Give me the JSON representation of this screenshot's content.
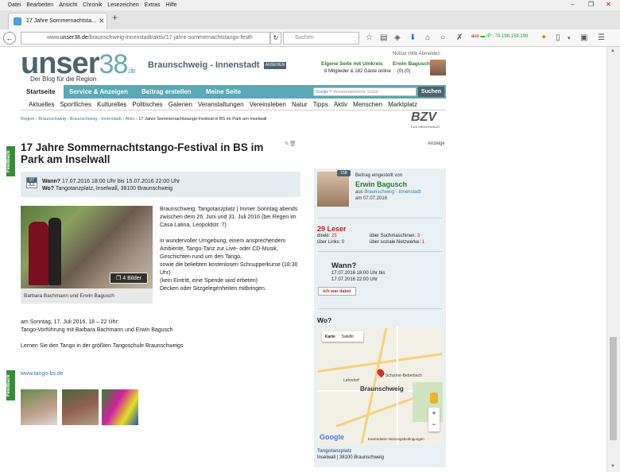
{
  "browser": {
    "menu": [
      "Datei",
      "Bearbeiten",
      "Ansicht",
      "Chronik",
      "Lesezeichen",
      "Extras",
      "Hilfe"
    ],
    "tab_title": "17 Jahre Sommernachtsta...",
    "url_prefix": "www.",
    "url_domain": "unser38.de",
    "url_path": "/braunschweig-innenstadt/aktiv/17-jahre-sommernachtstango-festh",
    "search_placeholder": "Suchen",
    "ip_label": "aus",
    "ip_text": "IP : 79.198.159.198"
  },
  "header": {
    "logo_main": "unser",
    "logo_num": "38",
    "logo_de": ".de",
    "tagline": "Der Blog für die Region",
    "region": "Braunschweig - Innenstadt",
    "region_badge": "ANSEHEN",
    "toplinks": "Nutzer   Hilfe   Abmelden",
    "eigene": "Eigene Seite mit Umkreis",
    "mitglied": "8 Mitglieder & 182 Gäste online",
    "username": "Erwin Bagusch",
    "usercounts": "(0)  (0)"
  },
  "nav": {
    "tabs": [
      "Startseite",
      "Service & Anzeigen",
      "Beitrag erstellen",
      "Meine Seite"
    ],
    "search_placeholder": "Benutzerdefinierte Suche",
    "search_btn": "Suchen",
    "sub": [
      "Aktuelles",
      "Sportliches",
      "Kulturelles",
      "Politisches",
      "Galerien",
      "Veranstaltungen",
      "Vereinsleben",
      "Natur",
      "Tipps",
      "Aktiv",
      "Menschen",
      "Marktplatz"
    ]
  },
  "breadcrumb": {
    "items": [
      "Region",
      "Braunschweig",
      "Braunschweig - Innenstadt",
      "Aktiv"
    ],
    "current": "17 Jahre Sommernachtstango-Festival in BS im Park am Inselwall"
  },
  "bzv": {
    "logo": "BZV",
    "sub": "DAS MEDIENHAUS"
  },
  "article": {
    "title": "17 Jahre Sommernachtstango-Festival in BS im Park am Inselwall",
    "anzeige": "Anzeige",
    "cal_month": "07",
    "cal_day": "JUL",
    "wann_label": "Wann?",
    "wann_value": "17.07.2016 18:00 Uhr bis 15.07.2016 22:00 Uhr",
    "wo_label": "Wo?",
    "wo_value": "Tangotanzplatz, Inselwall, 38100 Braunschweig",
    "bilder": "4 Bilder",
    "caption": "Barbara Bachmann und Erwin Bagusch",
    "p1": "Braunschweig: Tangotanzplatz | Immer Sonntag abends zwischen dem 26. Juni und 31. Juli 2016 (bei Regen im Casa Latina, Leopoldstr. 7)",
    "p2": "in wundervoller Umgebung, einem ansprechendem",
    "p3": "Ambiente, Tango-Tanz zur Live- oder CD-Musik, Geschichten rund um den Tango,",
    "p4": "sowie die beliebten kostenlosen Schnupperkurse (18:30 Uhr)",
    "p5": "(kein Eintritt, eine Spende wird erbeten)",
    "p6": "Decken oder Sitzgelegenheiten mitbringen.",
    "p7": "am Sonntag, 17. Juli 2016, 18 – 22 Uhr:",
    "p8": "Tango-Vorführung mit Barbara Bachmann und Erwin Bagusch",
    "p9": "Lernen Sie den Tango in der größten Tangoschule Braunschweigs",
    "link": "www.tango-bs.de",
    "feedback": "Feedback"
  },
  "sidebar": {
    "count": "158",
    "posted_by": "Beitrag eingestellt von",
    "name": "Erwin Bagusch",
    "aus_label": "aus",
    "aus_region": "Braunschweig - Innenstadt",
    "am": "am 07.07.2016",
    "leser": "29 Leser",
    "direkt_label": "direkt:",
    "direkt_val": "25",
    "links_label": "über Links:",
    "links_val": "0",
    "such_label": "über Suchmaschinen:",
    "such_val": "3",
    "soz_label": "über soziale Netzwerke:",
    "soz_val": "1",
    "wann": "Wann?",
    "wann_1": "17.07.2016 18:00 Uhr bis",
    "wann_2": "17.07.2016 22:00 Uhr",
    "dabei_btn": "Ich war dabei",
    "wo": "Wo?",
    "map_tab1": "Karte",
    "map_tab2": "Satellit",
    "map_city": "Braunschweig",
    "map_lehndorf": "Lehndorf",
    "map_schunter": "Schunter-Beberbach",
    "map_footer": "Kartendaten   Nutzungsbedingungen",
    "google": "Google",
    "place": "Tangotanzplatz",
    "address": "Inselwall | 38100 Braunschweig"
  }
}
